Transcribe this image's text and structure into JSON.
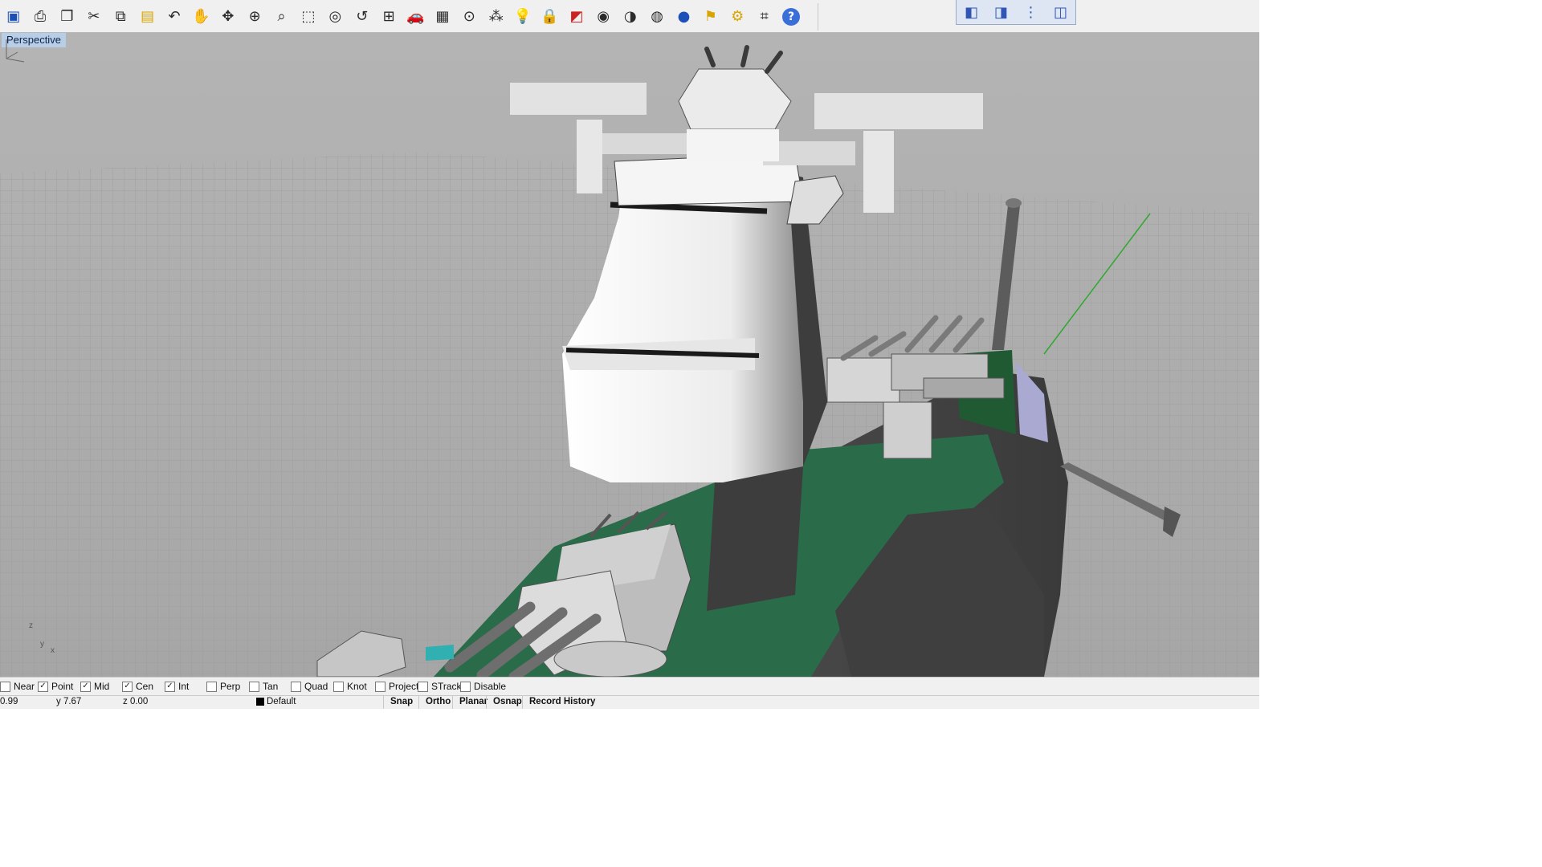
{
  "toolbar": {
    "icons": [
      {
        "name": "save-icon",
        "glyph": "▣"
      },
      {
        "name": "print-icon",
        "glyph": "⎙"
      },
      {
        "name": "open-document-icon",
        "glyph": "❐"
      },
      {
        "name": "cut-icon",
        "glyph": "✂"
      },
      {
        "name": "copy-icon",
        "glyph": "⧉"
      },
      {
        "name": "paste-icon",
        "glyph": "▤"
      },
      {
        "name": "undo-icon",
        "glyph": "↶"
      },
      {
        "name": "pan-hand-icon",
        "glyph": "✋"
      },
      {
        "name": "rotate-view-icon",
        "glyph": "✥"
      },
      {
        "name": "zoom-dynamic-icon",
        "glyph": "⊕"
      },
      {
        "name": "zoom-window-icon",
        "glyph": "⌕"
      },
      {
        "name": "zoom-extents-icon",
        "glyph": "⬚"
      },
      {
        "name": "zoom-selected-icon",
        "glyph": "◎"
      },
      {
        "name": "undo-view-icon",
        "glyph": "↺"
      },
      {
        "name": "four-viewports-icon",
        "glyph": "⊞"
      },
      {
        "name": "car-icon",
        "glyph": "🚗"
      },
      {
        "name": "grid-plane-icon",
        "glyph": "▦"
      },
      {
        "name": "point-object-icon",
        "glyph": "⊙"
      },
      {
        "name": "osnap-points-icon",
        "glyph": "⁂"
      },
      {
        "name": "light-bulb-icon",
        "glyph": "💡"
      },
      {
        "name": "lock-icon",
        "glyph": "🔒"
      },
      {
        "name": "layer-icon",
        "glyph": "◩"
      },
      {
        "name": "color-wheel-icon",
        "glyph": "◉"
      },
      {
        "name": "shaded-sphere-icon",
        "glyph": "◑"
      },
      {
        "name": "wireframe-sphere-icon",
        "glyph": "◍"
      },
      {
        "name": "render-sphere-icon",
        "glyph": "●"
      },
      {
        "name": "flag-icon",
        "glyph": "⚑"
      },
      {
        "name": "settings-gear-icon",
        "glyph": "⚙"
      },
      {
        "name": "dimension-icon",
        "glyph": "⌗"
      },
      {
        "name": "help-icon",
        "glyph": "?"
      }
    ],
    "view_tools": [
      {
        "name": "view-3d-box-icon",
        "glyph": "◧"
      },
      {
        "name": "view-front-icon",
        "glyph": "◨"
      },
      {
        "name": "view-side-icon",
        "glyph": "⋮"
      },
      {
        "name": "view-layout-icon",
        "glyph": "◫"
      }
    ]
  },
  "viewport": {
    "title": "Perspective",
    "axis": {
      "z": "z",
      "y": "y",
      "x": "x"
    }
  },
  "osnap": [
    {
      "label": "Near",
      "checked": false
    },
    {
      "label": "Point",
      "checked": true
    },
    {
      "label": "Mid",
      "checked": true
    },
    {
      "label": "Cen",
      "checked": true
    },
    {
      "label": "Int",
      "checked": true
    },
    {
      "label": "Perp",
      "checked": false
    },
    {
      "label": "Tan",
      "checked": false
    },
    {
      "label": "Quad",
      "checked": false
    },
    {
      "label": "Knot",
      "checked": false
    },
    {
      "label": "Project",
      "checked": false
    },
    {
      "label": "STrack",
      "checked": false
    },
    {
      "label": "Disable",
      "checked": false
    }
  ],
  "status": {
    "x": "0.99",
    "y": "y 7.67",
    "z": "z 0.00",
    "layer": "Default",
    "panes": [
      "Snap",
      "Ortho",
      "Planar",
      "Osnap",
      "Record History"
    ]
  },
  "colors": {
    "viewport_bg": "#aeaeae",
    "deck_green": "#2a6b49",
    "axis_green": "#2fa82f",
    "hull_dark": "#4a4a4a",
    "bridge_white": "#f2f2f2"
  }
}
